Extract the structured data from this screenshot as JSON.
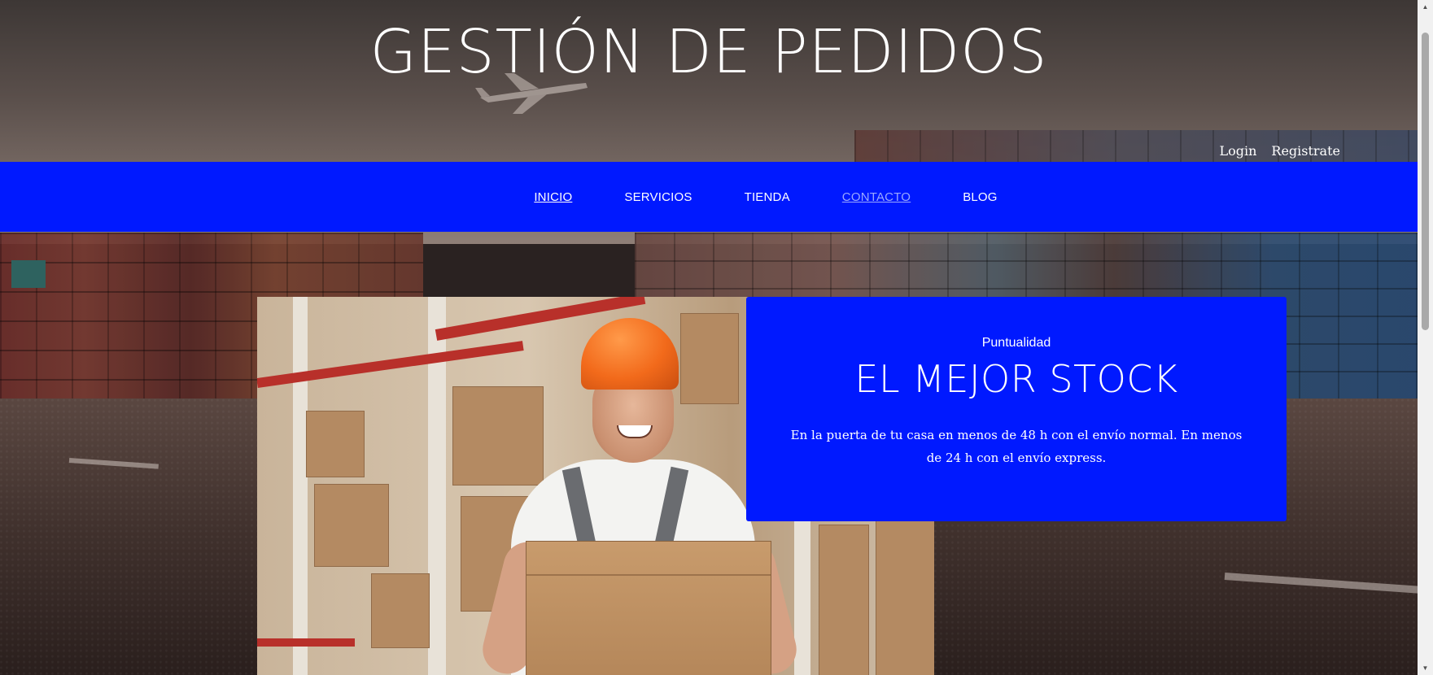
{
  "header": {
    "title": "GESTIÓN DE PEDIDOS",
    "auth": {
      "login_label": "Login",
      "register_label": "Registrate"
    }
  },
  "nav": {
    "items": [
      {
        "label": "INICIO",
        "state": "active"
      },
      {
        "label": "SERVICIOS",
        "state": "default"
      },
      {
        "label": "TIENDA",
        "state": "default"
      },
      {
        "label": "CONTACTO",
        "state": "visited"
      },
      {
        "label": "BLOG",
        "state": "default"
      }
    ]
  },
  "hero": {
    "kicker": "Puntualidad",
    "heading": "EL MEJOR STOCK",
    "body": "En la puerta de tu casa en menos de 48 h con el envío normal. En menos de 24 h con el envío express.",
    "image_subject": "warehouse-worker-holding-box"
  },
  "colors": {
    "brand_blue": "#0019ff",
    "text_light": "#ffffff",
    "visited_link": "#9aa7ff",
    "helmet_orange": "#f26a1b"
  }
}
